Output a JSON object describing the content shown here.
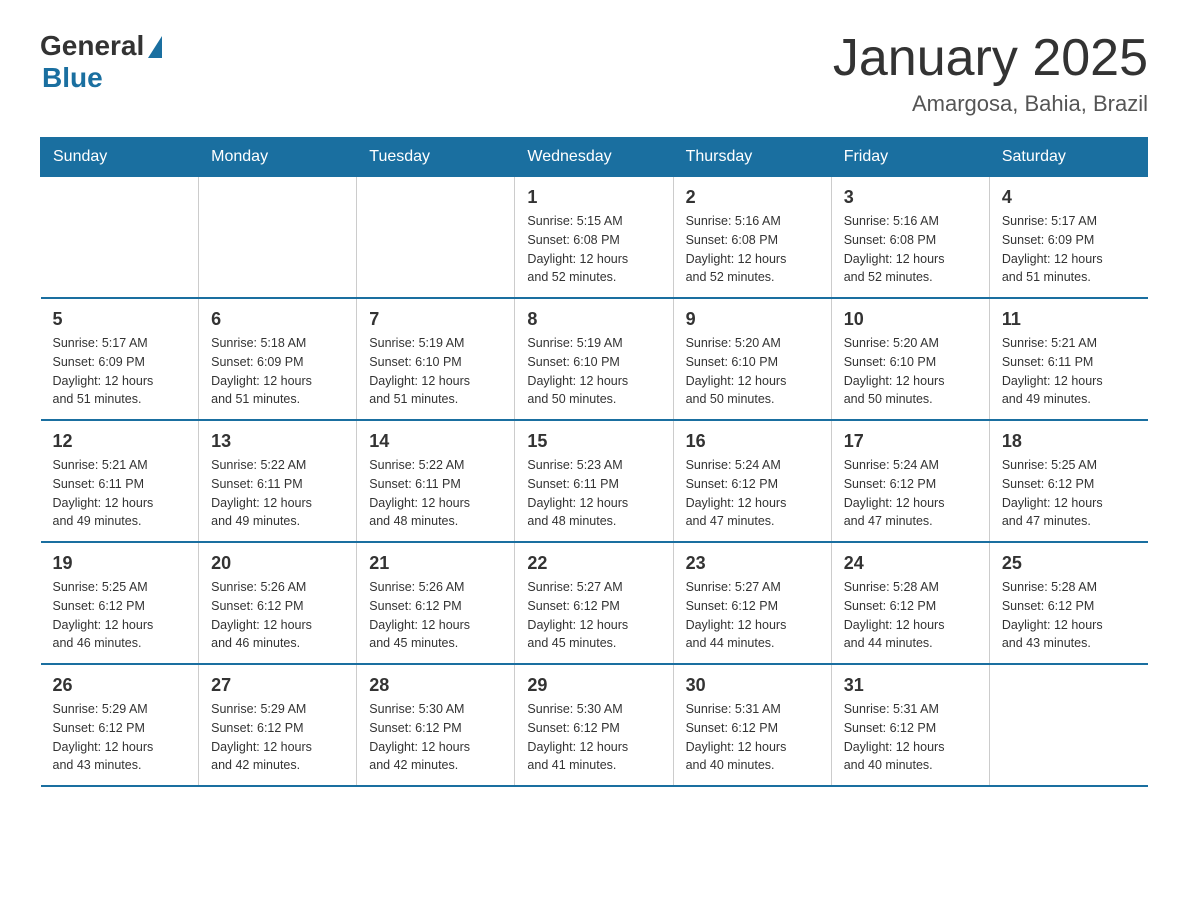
{
  "header": {
    "logo_general": "General",
    "logo_blue": "Blue",
    "title": "January 2025",
    "subtitle": "Amargosa, Bahia, Brazil"
  },
  "days_of_week": [
    "Sunday",
    "Monday",
    "Tuesday",
    "Wednesday",
    "Thursday",
    "Friday",
    "Saturday"
  ],
  "weeks": [
    [
      {
        "day": "",
        "info": ""
      },
      {
        "day": "",
        "info": ""
      },
      {
        "day": "",
        "info": ""
      },
      {
        "day": "1",
        "info": "Sunrise: 5:15 AM\nSunset: 6:08 PM\nDaylight: 12 hours\nand 52 minutes."
      },
      {
        "day": "2",
        "info": "Sunrise: 5:16 AM\nSunset: 6:08 PM\nDaylight: 12 hours\nand 52 minutes."
      },
      {
        "day": "3",
        "info": "Sunrise: 5:16 AM\nSunset: 6:08 PM\nDaylight: 12 hours\nand 52 minutes."
      },
      {
        "day": "4",
        "info": "Sunrise: 5:17 AM\nSunset: 6:09 PM\nDaylight: 12 hours\nand 51 minutes."
      }
    ],
    [
      {
        "day": "5",
        "info": "Sunrise: 5:17 AM\nSunset: 6:09 PM\nDaylight: 12 hours\nand 51 minutes."
      },
      {
        "day": "6",
        "info": "Sunrise: 5:18 AM\nSunset: 6:09 PM\nDaylight: 12 hours\nand 51 minutes."
      },
      {
        "day": "7",
        "info": "Sunrise: 5:19 AM\nSunset: 6:10 PM\nDaylight: 12 hours\nand 51 minutes."
      },
      {
        "day": "8",
        "info": "Sunrise: 5:19 AM\nSunset: 6:10 PM\nDaylight: 12 hours\nand 50 minutes."
      },
      {
        "day": "9",
        "info": "Sunrise: 5:20 AM\nSunset: 6:10 PM\nDaylight: 12 hours\nand 50 minutes."
      },
      {
        "day": "10",
        "info": "Sunrise: 5:20 AM\nSunset: 6:10 PM\nDaylight: 12 hours\nand 50 minutes."
      },
      {
        "day": "11",
        "info": "Sunrise: 5:21 AM\nSunset: 6:11 PM\nDaylight: 12 hours\nand 49 minutes."
      }
    ],
    [
      {
        "day": "12",
        "info": "Sunrise: 5:21 AM\nSunset: 6:11 PM\nDaylight: 12 hours\nand 49 minutes."
      },
      {
        "day": "13",
        "info": "Sunrise: 5:22 AM\nSunset: 6:11 PM\nDaylight: 12 hours\nand 49 minutes."
      },
      {
        "day": "14",
        "info": "Sunrise: 5:22 AM\nSunset: 6:11 PM\nDaylight: 12 hours\nand 48 minutes."
      },
      {
        "day": "15",
        "info": "Sunrise: 5:23 AM\nSunset: 6:11 PM\nDaylight: 12 hours\nand 48 minutes."
      },
      {
        "day": "16",
        "info": "Sunrise: 5:24 AM\nSunset: 6:12 PM\nDaylight: 12 hours\nand 47 minutes."
      },
      {
        "day": "17",
        "info": "Sunrise: 5:24 AM\nSunset: 6:12 PM\nDaylight: 12 hours\nand 47 minutes."
      },
      {
        "day": "18",
        "info": "Sunrise: 5:25 AM\nSunset: 6:12 PM\nDaylight: 12 hours\nand 47 minutes."
      }
    ],
    [
      {
        "day": "19",
        "info": "Sunrise: 5:25 AM\nSunset: 6:12 PM\nDaylight: 12 hours\nand 46 minutes."
      },
      {
        "day": "20",
        "info": "Sunrise: 5:26 AM\nSunset: 6:12 PM\nDaylight: 12 hours\nand 46 minutes."
      },
      {
        "day": "21",
        "info": "Sunrise: 5:26 AM\nSunset: 6:12 PM\nDaylight: 12 hours\nand 45 minutes."
      },
      {
        "day": "22",
        "info": "Sunrise: 5:27 AM\nSunset: 6:12 PM\nDaylight: 12 hours\nand 45 minutes."
      },
      {
        "day": "23",
        "info": "Sunrise: 5:27 AM\nSunset: 6:12 PM\nDaylight: 12 hours\nand 44 minutes."
      },
      {
        "day": "24",
        "info": "Sunrise: 5:28 AM\nSunset: 6:12 PM\nDaylight: 12 hours\nand 44 minutes."
      },
      {
        "day": "25",
        "info": "Sunrise: 5:28 AM\nSunset: 6:12 PM\nDaylight: 12 hours\nand 43 minutes."
      }
    ],
    [
      {
        "day": "26",
        "info": "Sunrise: 5:29 AM\nSunset: 6:12 PM\nDaylight: 12 hours\nand 43 minutes."
      },
      {
        "day": "27",
        "info": "Sunrise: 5:29 AM\nSunset: 6:12 PM\nDaylight: 12 hours\nand 42 minutes."
      },
      {
        "day": "28",
        "info": "Sunrise: 5:30 AM\nSunset: 6:12 PM\nDaylight: 12 hours\nand 42 minutes."
      },
      {
        "day": "29",
        "info": "Sunrise: 5:30 AM\nSunset: 6:12 PM\nDaylight: 12 hours\nand 41 minutes."
      },
      {
        "day": "30",
        "info": "Sunrise: 5:31 AM\nSunset: 6:12 PM\nDaylight: 12 hours\nand 40 minutes."
      },
      {
        "day": "31",
        "info": "Sunrise: 5:31 AM\nSunset: 6:12 PM\nDaylight: 12 hours\nand 40 minutes."
      },
      {
        "day": "",
        "info": ""
      }
    ]
  ]
}
